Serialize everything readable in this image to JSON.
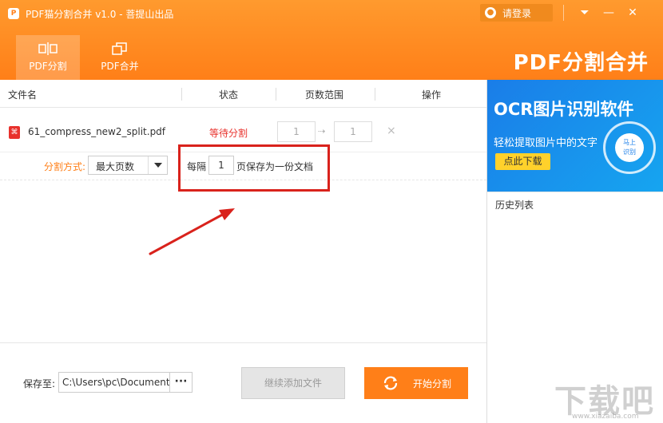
{
  "app": {
    "icon_glyph": "P",
    "title": "PDF猫分割合并 v1.0 - 菩提山出品",
    "login_label": "请登录",
    "brand": "PDF分割合并"
  },
  "window_controls": {
    "menu_icon": "chevron-down-icon",
    "minimize_icon": "minimize-icon",
    "close_icon": "close-icon",
    "menu_glyph": "⏷",
    "minimize_glyph": "—",
    "close_glyph": "✕"
  },
  "tabs": [
    {
      "label": "PDF分割",
      "icon": "split-icon",
      "active": true
    },
    {
      "label": "PDF合并",
      "icon": "merge-icon",
      "active": false
    }
  ],
  "table": {
    "headers": [
      "文件名",
      "状态",
      "页数范围",
      "操作"
    ],
    "rows": [
      {
        "file_name": "61_compress_new2_split.pdf",
        "status": "等待分割",
        "range_from": "1",
        "range_to": "1",
        "range_arrow": "⇢",
        "delete_glyph": "×"
      }
    ]
  },
  "split_options": {
    "label": "分割方式:",
    "mode_value": "最大页数",
    "every_prefix": "每隔",
    "every_value": "1",
    "every_suffix": "页保存为一份文档"
  },
  "footer": {
    "save_label": "保存至:",
    "save_path": "C:\\Users\\pc\\Document",
    "browse_label": "···",
    "add_files_label": "继续添加文件",
    "start_label": "开始分割"
  },
  "ad": {
    "title": "OCR图片识别软件",
    "subtitle": "轻松提取图片中的文字",
    "button": "点此下载",
    "badge_line1": "马上",
    "badge_line2": "识别"
  },
  "history": {
    "label": "历史列表"
  },
  "watermark": {
    "text": "下载吧",
    "url": "www.xiazaiba.com"
  },
  "colors": {
    "accent": "#ff7f18",
    "status_red": "#e8312c",
    "ad_blue": "#1a7de8",
    "ad_button": "#ffd12b",
    "annotation_red": "#d9221c"
  }
}
